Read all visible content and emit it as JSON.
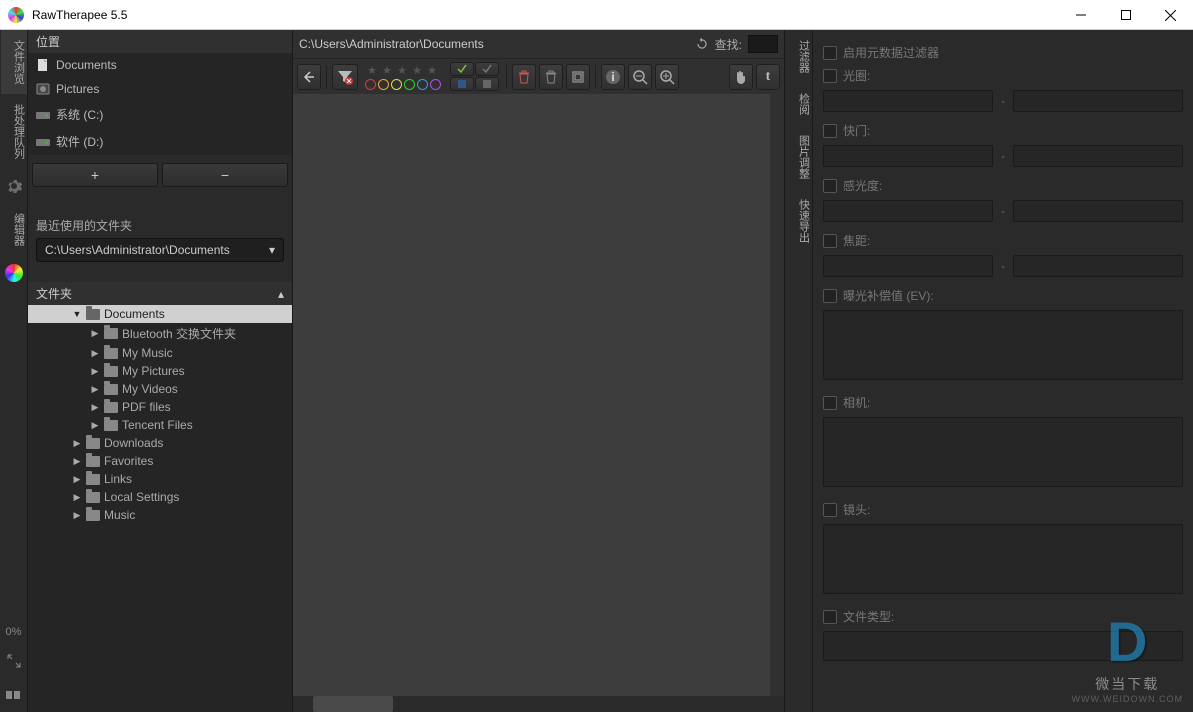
{
  "window": {
    "title": "RawTherapee 5.5"
  },
  "leftTabs": {
    "fileBrowser": "文件浏览",
    "batchQueue": "批处理队列",
    "editor": "编辑器",
    "progress": "0%"
  },
  "places": {
    "header": "位置",
    "items": [
      {
        "label": "Documents",
        "icon": "doc"
      },
      {
        "label": "Pictures",
        "icon": "pic"
      },
      {
        "label": "系统 (C:)",
        "icon": "drive"
      },
      {
        "label": "软件 (D:)",
        "icon": "drive"
      }
    ],
    "addBtn": "+",
    "removeBtn": "−"
  },
  "recent": {
    "label": "最近使用的文件夹",
    "path": "C:\\Users\\Administrator\\Documents"
  },
  "folderTree": {
    "header": "文件夹",
    "nodes": [
      {
        "indent": 2,
        "label": "Documents",
        "expanded": true,
        "selected": true,
        "hasChildren": true
      },
      {
        "indent": 3,
        "label": "Bluetooth 交换文件夹",
        "hasChildren": true
      },
      {
        "indent": 3,
        "label": "My Music",
        "hasChildren": true
      },
      {
        "indent": 3,
        "label": "My Pictures",
        "hasChildren": true
      },
      {
        "indent": 3,
        "label": "My Videos",
        "hasChildren": true
      },
      {
        "indent": 3,
        "label": "PDF files",
        "hasChildren": true
      },
      {
        "indent": 3,
        "label": "Tencent Files",
        "hasChildren": true
      },
      {
        "indent": 2,
        "label": "Downloads",
        "hasChildren": true
      },
      {
        "indent": 2,
        "label": "Favorites",
        "hasChildren": true
      },
      {
        "indent": 2,
        "label": "Links",
        "hasChildren": true
      },
      {
        "indent": 2,
        "label": "Local Settings",
        "hasChildren": true
      },
      {
        "indent": 2,
        "label": "Music",
        "hasChildren": true
      }
    ]
  },
  "pathbar": {
    "path": "C:\\Users\\Administrator\\Documents",
    "findLabel": "查找:"
  },
  "colorDots": [
    "#e33",
    "#ea3",
    "#dd3",
    "#3c3",
    "#39d",
    "#a5d"
  ],
  "rightTabs": {
    "filter": "过滤器",
    "inspect": "检阅",
    "batchEdit": "图片调整",
    "fastExport": "快速导出"
  },
  "filters": {
    "enableMeta": "启用元数据过滤器",
    "aperture": "光圈:",
    "shutter": "快门:",
    "iso": "感光度:",
    "focal": "焦距:",
    "evComp": "曝光补偿值 (EV):",
    "camera": "相机:",
    "lens": "镜头:",
    "filetype": "文件类型:"
  },
  "watermark": {
    "line1": "微当下载",
    "line2": "WWW.WEIDOWN.COM"
  }
}
